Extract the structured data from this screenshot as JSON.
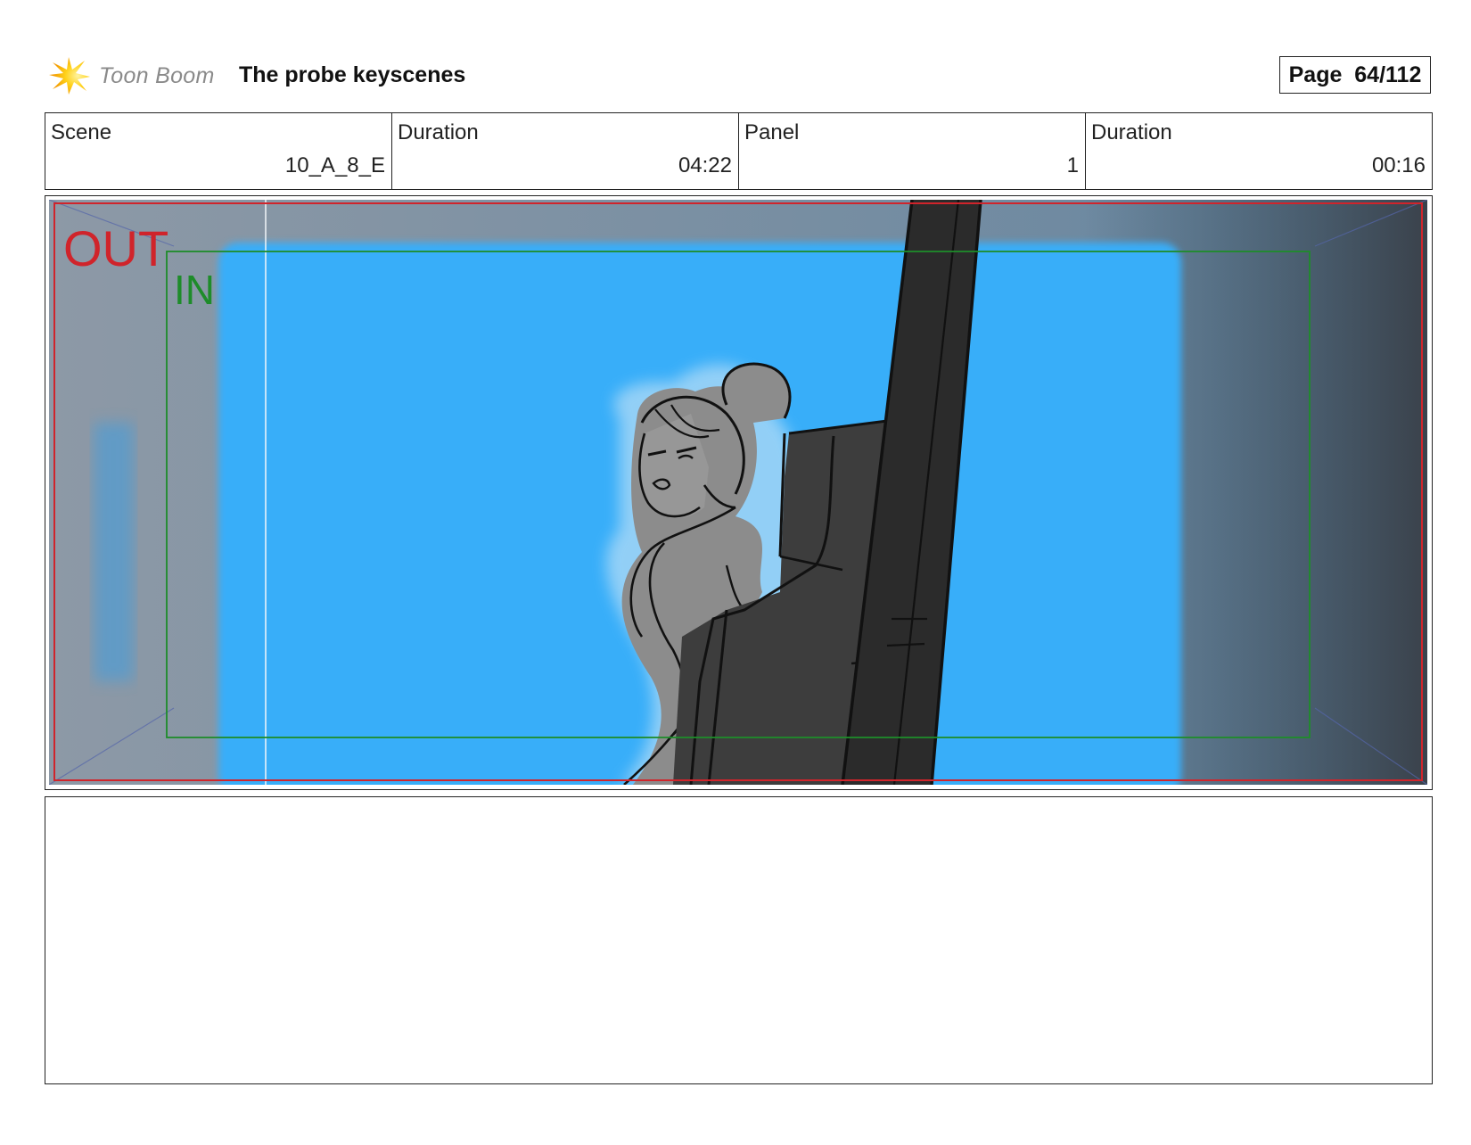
{
  "header": {
    "logo_text": "Toon Boom",
    "project_title": "The probe keyscenes",
    "page_label": "Page",
    "page_number": "64/112"
  },
  "info": {
    "scene_label": "Scene",
    "scene_value": "10_A_8_E",
    "scene_duration_label": "Duration",
    "scene_duration_value": "04:22",
    "panel_label": "Panel",
    "panel_value": "1",
    "panel_duration_label": "Duration",
    "panel_duration_value": "00:16"
  },
  "panel": {
    "out_label": "OUT",
    "in_label": "IN",
    "colors": {
      "out_frame": "#d0242b",
      "in_frame": "#1e8c2a",
      "screen_blue": "#39aef9",
      "wall_gray": "#7b8c9c"
    }
  },
  "notes": {}
}
